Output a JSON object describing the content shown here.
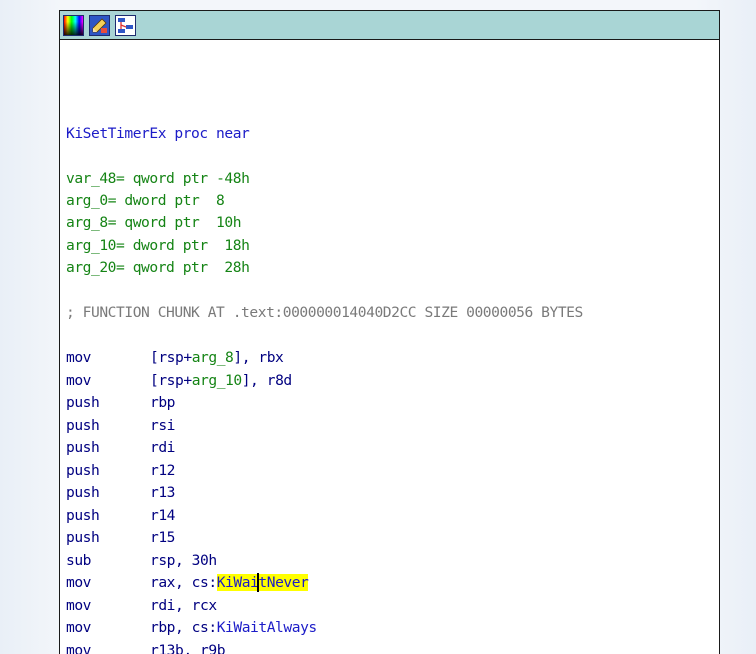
{
  "window": {
    "toolbar": {
      "icons": [
        {
          "name": "node-color-icon"
        },
        {
          "name": "rename-icon"
        },
        {
          "name": "graph-overview-icon"
        }
      ]
    }
  },
  "colors": {
    "titlebar": "#a9d5d5",
    "label": "#1c1cc8",
    "var": "#158415",
    "comment": "#7a7a7a",
    "operand": "#000080",
    "highlight": "#ffff00"
  },
  "proc": {
    "header": "KiSetTimerEx proc near"
  },
  "vars": [
    {
      "name": "var_48",
      "def": "= qword ptr -48h"
    },
    {
      "name": "arg_0",
      "def": "= dword ptr  8"
    },
    {
      "name": "arg_8",
      "def": "= qword ptr  10h"
    },
    {
      "name": "arg_10",
      "def": "= dword ptr  18h"
    },
    {
      "name": "arg_20",
      "def": "= qword ptr  28h"
    }
  ],
  "comment": "; FUNCTION CHUNK AT .text:000000014040D2CC SIZE 00000056 BYTES",
  "instructions": {
    "i0": {
      "mnemonic": "mov",
      "pre": "[rsp+",
      "var": "arg_8",
      "post": "], rbx"
    },
    "i1": {
      "mnemonic": "mov",
      "pre": "[rsp+",
      "var": "arg_10",
      "post": "], r8d"
    },
    "i2": {
      "mnemonic": "push",
      "operands": "rbp"
    },
    "i3": {
      "mnemonic": "push",
      "operands": "rsi"
    },
    "i4": {
      "mnemonic": "push",
      "operands": "rdi"
    },
    "i5": {
      "mnemonic": "push",
      "operands": "r12"
    },
    "i6": {
      "mnemonic": "push",
      "operands": "r13"
    },
    "i7": {
      "mnemonic": "push",
      "operands": "r14"
    },
    "i8": {
      "mnemonic": "push",
      "operands": "r15"
    },
    "i9": {
      "mnemonic": "sub",
      "operands": "rsp, 30h"
    },
    "i10": {
      "mnemonic": "mov",
      "pre": "rax, cs:",
      "sym_a": "KiWai",
      "sym_b": "tNever"
    },
    "i11": {
      "mnemonic": "mov",
      "operands": "rdi, rcx"
    },
    "i12": {
      "mnemonic": "mov",
      "pre": "rbp, cs:",
      "sym": "KiWaitAlways"
    },
    "i13": {
      "mnemonic": "mov",
      "operands": "r13b, r9b"
    }
  }
}
